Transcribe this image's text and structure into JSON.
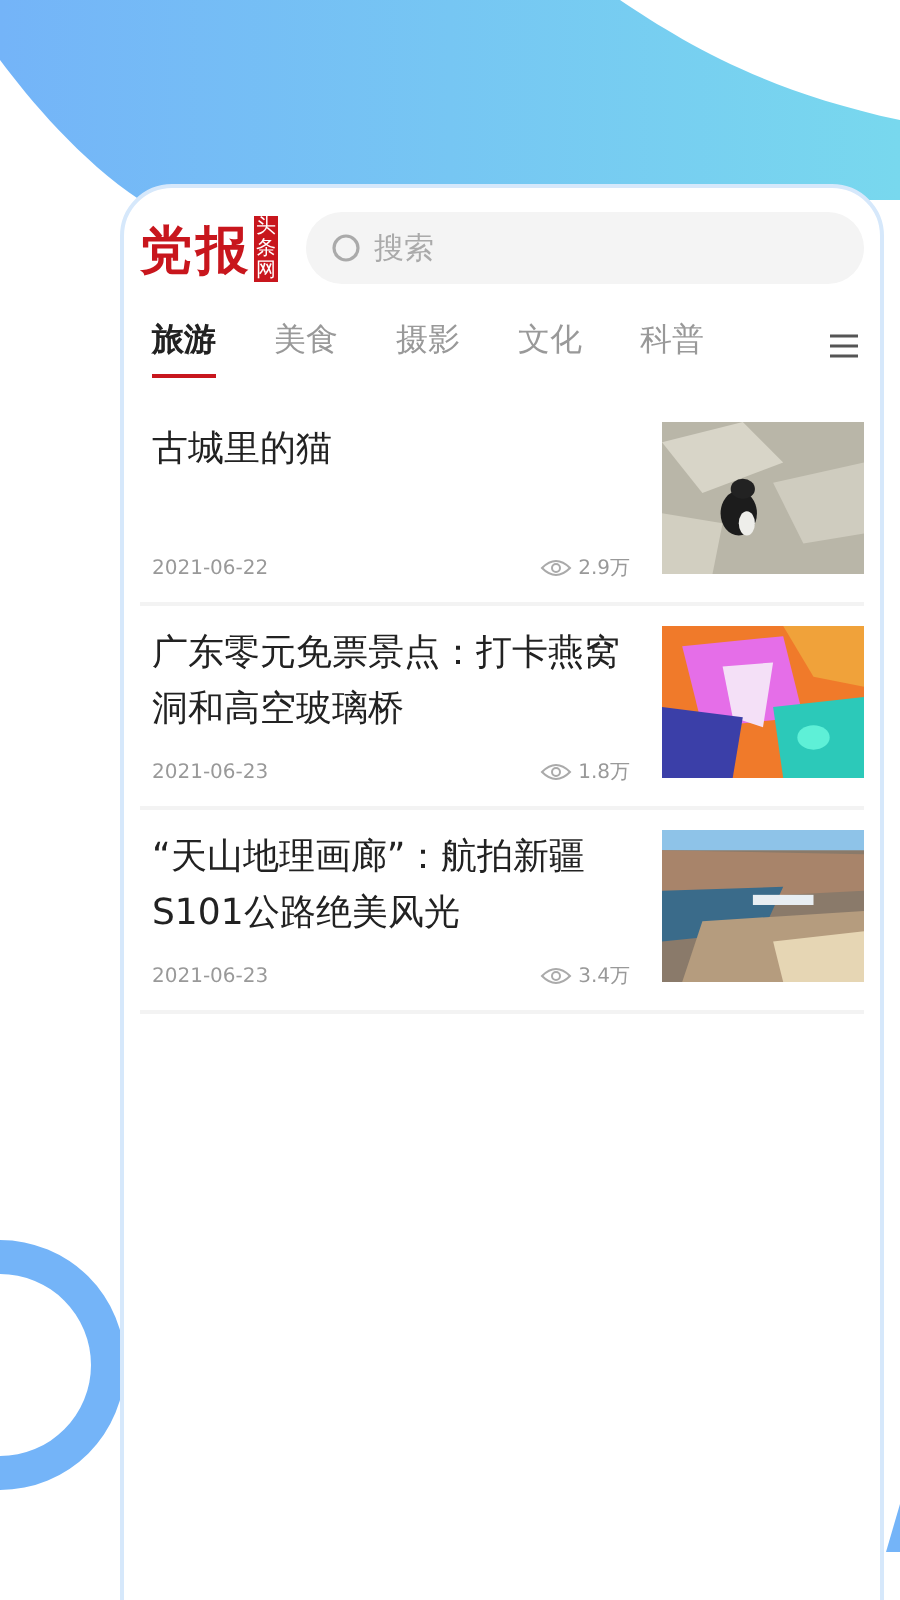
{
  "logo": {
    "title": "党报",
    "badge": "头条网"
  },
  "search": {
    "placeholder": "搜索"
  },
  "tabs": [
    {
      "label": "旅游",
      "selected": true
    },
    {
      "label": "美食",
      "selected": false
    },
    {
      "label": "摄影",
      "selected": false
    },
    {
      "label": "文化",
      "selected": false
    },
    {
      "label": "科普",
      "selected": false
    }
  ],
  "articles": [
    {
      "title": "古城里的猫",
      "date": "2021-06-22",
      "views": "2.9万"
    },
    {
      "title": "广东零元免票景点：打卡燕窝洞和高空玻璃桥",
      "date": "2021-06-23",
      "views": "1.8万"
    },
    {
      "title": "“天山地理画廊”：航拍新疆S101公路绝美风光",
      "date": "2021-06-23",
      "views": "3.4万"
    }
  ]
}
